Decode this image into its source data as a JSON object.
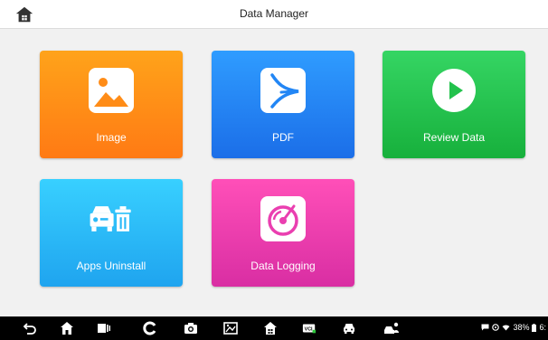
{
  "header": {
    "title": "Data Manager"
  },
  "tiles": [
    {
      "label": "Image",
      "icon": "image-icon",
      "color": "#ff8c17"
    },
    {
      "label": "PDF",
      "icon": "pdf-icon",
      "color": "#2286f5"
    },
    {
      "label": "Review Data",
      "icon": "play-icon",
      "color": "#22c24c"
    },
    {
      "label": "Apps Uninstall",
      "icon": "car-trash-icon",
      "color": "#2cbaf8"
    },
    {
      "label": "Data Logging",
      "icon": "data-logging-icon",
      "color": "#ea3fb0"
    }
  ],
  "navbar": {
    "icons": [
      "back-icon",
      "home-icon",
      "recent-apps-icon",
      "autel-icon",
      "camera-icon",
      "screenshot-icon",
      "home-garage-icon",
      "vci-icon",
      "car-icon",
      "vehicle-user-icon"
    ]
  },
  "status": {
    "battery": "38%",
    "time": "6:"
  }
}
